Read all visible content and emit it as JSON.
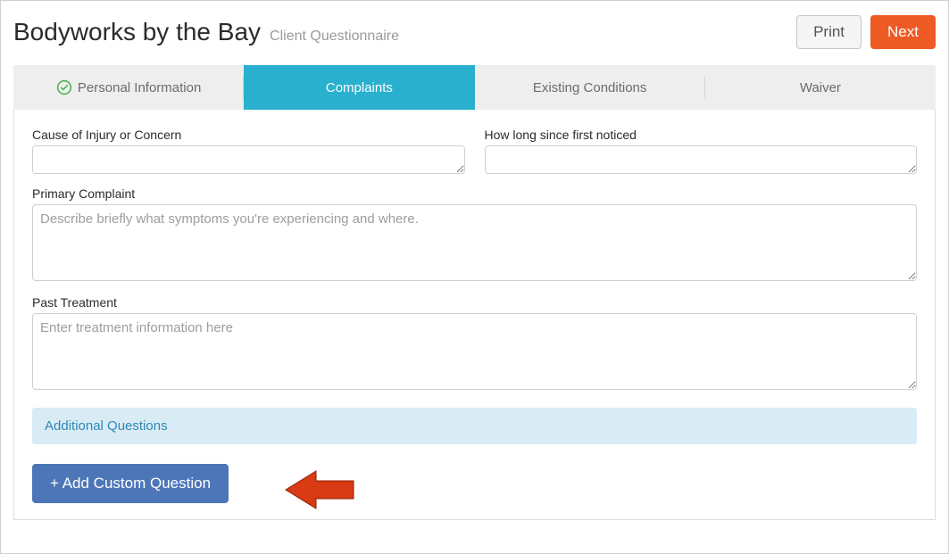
{
  "header": {
    "title": "Bodyworks by the Bay",
    "subtitle": "Client Questionnaire",
    "print_label": "Print",
    "next_label": "Next"
  },
  "tabs": {
    "items": [
      {
        "label": "Personal Information",
        "completed": true,
        "active": false
      },
      {
        "label": "Complaints",
        "completed": false,
        "active": true
      },
      {
        "label": "Existing Conditions",
        "completed": false,
        "active": false
      },
      {
        "label": "Waiver",
        "completed": false,
        "active": false
      }
    ]
  },
  "form": {
    "cause_label": "Cause of Injury or Concern",
    "cause_value": "",
    "howlong_label": "How long since first noticed",
    "howlong_value": "",
    "primary_label": "Primary Complaint",
    "primary_placeholder": "Describe briefly what symptoms you're experiencing and where.",
    "primary_value": "",
    "past_label": "Past Treatment",
    "past_placeholder": "Enter treatment information here",
    "past_value": "",
    "additional_heading": "Additional Questions",
    "add_question_label": "+ Add Custom Question"
  },
  "colors": {
    "accent_tab": "#29b0ce",
    "primary_button": "#ee5a24",
    "action_button": "#4d76b8",
    "info_bar_bg": "#d9ecf5",
    "info_bar_text": "#2f88b6"
  }
}
